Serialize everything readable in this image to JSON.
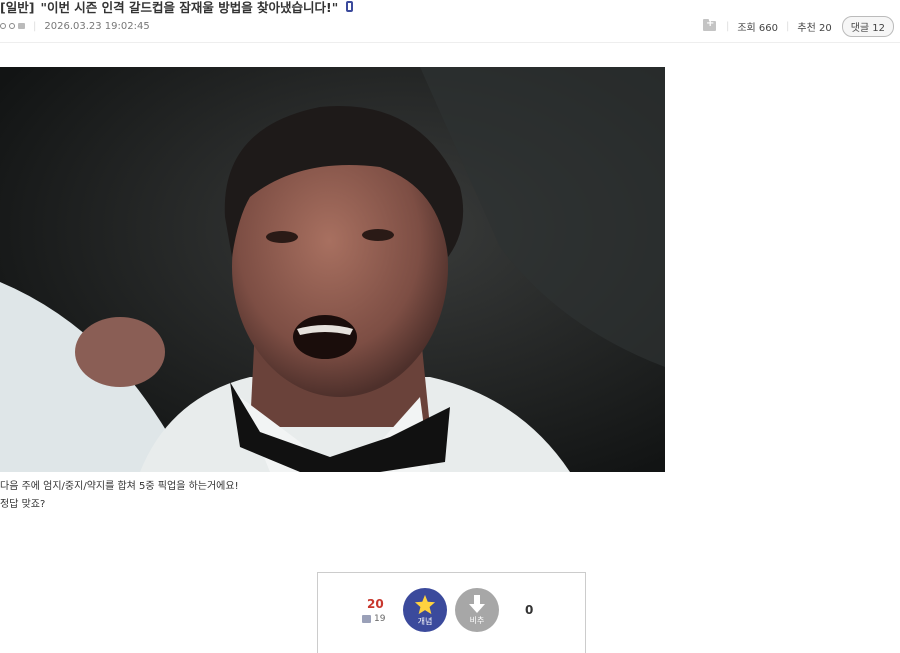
{
  "post": {
    "category": "[일반]",
    "title": "\"이번 시즌 인격 갈드컵을 잠재울 방법을 찾아냈습니다!\"",
    "date": "2026.03.23 19:02:45",
    "views_label": "조회 660",
    "recommend_label": "추천 20",
    "comments_label": "댓글 12",
    "body_lines": [
      "다음 주에 엄지/중지/약지를 합쳐 5중 픽업을 하는거에요!",
      "정답 맞죠?"
    ]
  },
  "vote": {
    "up_count": "20",
    "fixed_count": "19",
    "up_label": "개념",
    "down_label": "비추",
    "down_count": "0"
  },
  "colors": {
    "accent": "#3b4a9c",
    "up_count": "#c8372d",
    "down_button": "#a7a7a7"
  },
  "icons": {
    "mobile": "mobile-icon",
    "folder_add": "folder-add-icon",
    "star": "star-icon",
    "down_arrow": "down-arrow-icon"
  }
}
